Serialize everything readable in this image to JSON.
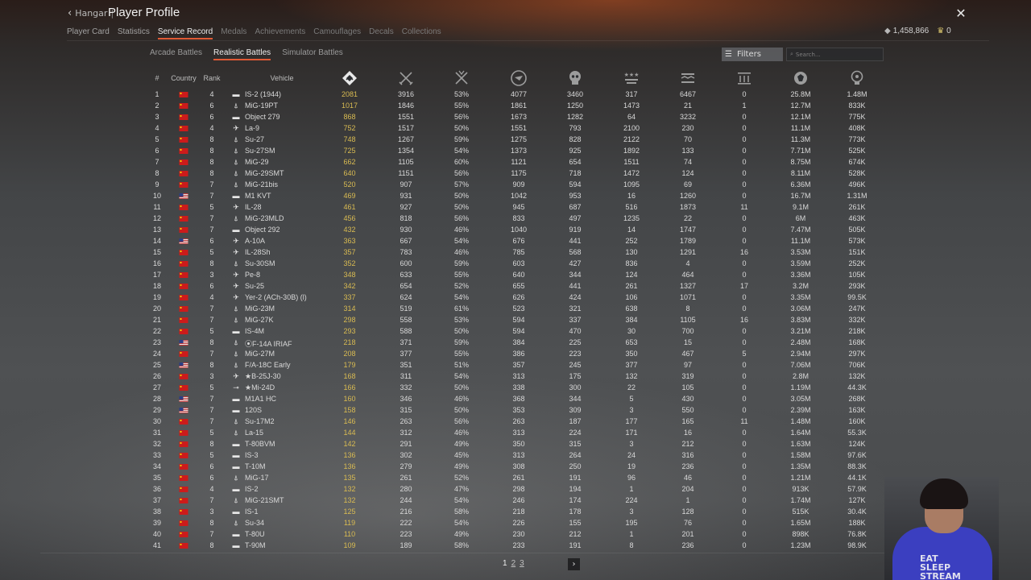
{
  "header": {
    "back_label": "Hangar",
    "title": "Player Profile",
    "tabs": [
      {
        "label": "Player Card",
        "state": "normal"
      },
      {
        "label": "Statistics",
        "state": "normal"
      },
      {
        "label": "Service Record",
        "state": "active"
      },
      {
        "label": "Medals",
        "state": "dim"
      },
      {
        "label": "Achievements",
        "state": "dim"
      },
      {
        "label": "Camouflages",
        "state": "dim"
      },
      {
        "label": "Decals",
        "state": "dim"
      },
      {
        "label": "Collections",
        "state": "dim"
      }
    ],
    "silver_lions": "1,458,866",
    "golden_eagles": "0"
  },
  "mode_tabs": [
    {
      "label": "Arcade Battles",
      "active": false
    },
    {
      "label": "Realistic Battles",
      "active": true
    },
    {
      "label": "Simulator Battles",
      "active": false
    }
  ],
  "filters_label": "Filters",
  "search_placeholder": "Search...",
  "table": {
    "headers": {
      "num": "#",
      "country": "Country",
      "rank": "Rank",
      "vehicle": "Vehicle"
    },
    "stat_icons": [
      "battles-icon",
      "victories-icon",
      "win-rate-icon",
      "respawns-icon",
      "deaths-icon",
      "air-kills-icon",
      "ground-kills-icon",
      "naval-kills-icon",
      "silver-earned-icon",
      "research-points-icon"
    ],
    "rows": [
      {
        "n": "1",
        "c": "cn",
        "r": "4",
        "ic": "tank",
        "v": "IS-2 (1944)",
        "s": [
          "2081",
          "3916",
          "53%",
          "4077",
          "3460",
          "317",
          "6467",
          "0",
          "25.8M",
          "1.48M"
        ]
      },
      {
        "n": "2",
        "c": "cn",
        "r": "6",
        "ic": "jet",
        "v": "MiG-19PT",
        "s": [
          "1017",
          "1846",
          "55%",
          "1861",
          "1250",
          "1473",
          "21",
          "1",
          "12.7M",
          "833K"
        ]
      },
      {
        "n": "3",
        "c": "cn",
        "r": "6",
        "ic": "tank",
        "v": "Object 279",
        "s": [
          "868",
          "1551",
          "56%",
          "1673",
          "1282",
          "64",
          "3232",
          "0",
          "12.1M",
          "775K"
        ]
      },
      {
        "n": "4",
        "c": "cn",
        "r": "4",
        "ic": "prop",
        "v": "La-9",
        "s": [
          "752",
          "1517",
          "50%",
          "1551",
          "793",
          "2100",
          "230",
          "0",
          "11.1M",
          "408K"
        ]
      },
      {
        "n": "5",
        "c": "cn",
        "r": "8",
        "ic": "jet",
        "v": "Su-27",
        "s": [
          "748",
          "1267",
          "59%",
          "1275",
          "828",
          "2122",
          "70",
          "0",
          "11.3M",
          "773K"
        ]
      },
      {
        "n": "6",
        "c": "cn",
        "r": "8",
        "ic": "jet",
        "v": "Su-27SM",
        "s": [
          "725",
          "1354",
          "54%",
          "1373",
          "925",
          "1892",
          "133",
          "0",
          "7.71M",
          "525K"
        ]
      },
      {
        "n": "7",
        "c": "cn",
        "r": "8",
        "ic": "jet",
        "v": "MiG-29",
        "s": [
          "662",
          "1105",
          "60%",
          "1121",
          "654",
          "1511",
          "74",
          "0",
          "8.75M",
          "674K"
        ]
      },
      {
        "n": "8",
        "c": "cn",
        "r": "8",
        "ic": "jet",
        "v": "MiG-29SMT",
        "s": [
          "640",
          "1151",
          "56%",
          "1175",
          "718",
          "1472",
          "124",
          "0",
          "8.11M",
          "528K"
        ]
      },
      {
        "n": "9",
        "c": "cn",
        "r": "7",
        "ic": "jet",
        "v": "MiG-21bis",
        "s": [
          "520",
          "907",
          "57%",
          "909",
          "594",
          "1095",
          "69",
          "0",
          "6.36M",
          "496K"
        ]
      },
      {
        "n": "10",
        "c": "us",
        "r": "7",
        "ic": "tank",
        "v": "M1 KVT",
        "s": [
          "469",
          "931",
          "50%",
          "1042",
          "953",
          "16",
          "1260",
          "0",
          "16.7M",
          "1.31M"
        ]
      },
      {
        "n": "11",
        "c": "cn",
        "r": "5",
        "ic": "prop",
        "v": "IL-28",
        "s": [
          "461",
          "927",
          "50%",
          "945",
          "687",
          "516",
          "1873",
          "11",
          "9.1M",
          "261K"
        ]
      },
      {
        "n": "12",
        "c": "cn",
        "r": "7",
        "ic": "jet",
        "v": "MiG-23MLD",
        "s": [
          "456",
          "818",
          "56%",
          "833",
          "497",
          "1235",
          "22",
          "0",
          "6M",
          "463K"
        ]
      },
      {
        "n": "13",
        "c": "cn",
        "r": "7",
        "ic": "tank",
        "v": "Object 292",
        "s": [
          "432",
          "930",
          "46%",
          "1040",
          "919",
          "14",
          "1747",
          "0",
          "7.47M",
          "505K"
        ]
      },
      {
        "n": "14",
        "c": "us",
        "r": "6",
        "ic": "prop",
        "v": "A-10A",
        "s": [
          "363",
          "667",
          "54%",
          "676",
          "441",
          "252",
          "1789",
          "0",
          "11.1M",
          "573K"
        ]
      },
      {
        "n": "15",
        "c": "cn",
        "r": "5",
        "ic": "prop",
        "v": "IL-28Sh",
        "s": [
          "357",
          "783",
          "46%",
          "785",
          "568",
          "130",
          "1291",
          "16",
          "3.53M",
          "151K"
        ]
      },
      {
        "n": "16",
        "c": "cn",
        "r": "8",
        "ic": "jet",
        "v": "Su-30SM",
        "s": [
          "352",
          "600",
          "59%",
          "603",
          "427",
          "836",
          "4",
          "0",
          "3.59M",
          "252K"
        ]
      },
      {
        "n": "17",
        "c": "cn",
        "r": "3",
        "ic": "prop",
        "v": "Pe-8",
        "s": [
          "348",
          "633",
          "55%",
          "640",
          "344",
          "124",
          "464",
          "0",
          "3.36M",
          "105K"
        ]
      },
      {
        "n": "18",
        "c": "cn",
        "r": "6",
        "ic": "prop",
        "v": "Su-25",
        "s": [
          "342",
          "654",
          "52%",
          "655",
          "441",
          "261",
          "1327",
          "17",
          "3.2M",
          "293K"
        ]
      },
      {
        "n": "19",
        "c": "cn",
        "r": "4",
        "ic": "prop",
        "v": "Yer-2 (ACh-30B) (l)",
        "s": [
          "337",
          "624",
          "54%",
          "626",
          "424",
          "106",
          "1071",
          "0",
          "3.35M",
          "99.5K"
        ]
      },
      {
        "n": "20",
        "c": "cn",
        "r": "7",
        "ic": "jet",
        "v": "MiG-23M",
        "s": [
          "314",
          "519",
          "61%",
          "523",
          "321",
          "638",
          "8",
          "0",
          "3.06M",
          "247K"
        ]
      },
      {
        "n": "21",
        "c": "cn",
        "r": "7",
        "ic": "jet",
        "v": "MiG-27K",
        "s": [
          "298",
          "558",
          "53%",
          "594",
          "337",
          "384",
          "1105",
          "16",
          "3.83M",
          "332K"
        ]
      },
      {
        "n": "22",
        "c": "cn",
        "r": "5",
        "ic": "tank",
        "v": "IS-4M",
        "s": [
          "293",
          "588",
          "50%",
          "594",
          "470",
          "30",
          "700",
          "0",
          "3.21M",
          "218K"
        ]
      },
      {
        "n": "23",
        "c": "us",
        "r": "8",
        "ic": "jet",
        "v": "⦿F-14A IRIAF",
        "s": [
          "218",
          "371",
          "59%",
          "384",
          "225",
          "653",
          "15",
          "0",
          "2.48M",
          "168K"
        ]
      },
      {
        "n": "24",
        "c": "cn",
        "r": "7",
        "ic": "jet",
        "v": "MiG-27M",
        "s": [
          "208",
          "377",
          "55%",
          "386",
          "223",
          "350",
          "467",
          "5",
          "2.94M",
          "297K"
        ]
      },
      {
        "n": "25",
        "c": "us",
        "r": "8",
        "ic": "jet",
        "v": "F/A-18C Early",
        "s": [
          "179",
          "351",
          "51%",
          "357",
          "245",
          "377",
          "97",
          "0",
          "7.06M",
          "706K"
        ]
      },
      {
        "n": "26",
        "c": "cn",
        "r": "3",
        "ic": "prop",
        "v": "★B-25J-30",
        "s": [
          "168",
          "311",
          "54%",
          "313",
          "175",
          "132",
          "319",
          "0",
          "2.8M",
          "132K"
        ]
      },
      {
        "n": "27",
        "c": "cn",
        "r": "5",
        "ic": "heli",
        "v": "★Mi-24D",
        "s": [
          "166",
          "332",
          "50%",
          "338",
          "300",
          "22",
          "105",
          "0",
          "1.19M",
          "44.3K"
        ]
      },
      {
        "n": "28",
        "c": "us",
        "r": "7",
        "ic": "tank",
        "v": "M1A1 HC",
        "s": [
          "160",
          "346",
          "46%",
          "368",
          "344",
          "5",
          "430",
          "0",
          "3.05M",
          "268K"
        ]
      },
      {
        "n": "29",
        "c": "us",
        "r": "7",
        "ic": "tank",
        "v": "120S",
        "s": [
          "158",
          "315",
          "50%",
          "353",
          "309",
          "3",
          "550",
          "0",
          "2.39M",
          "163K"
        ]
      },
      {
        "n": "30",
        "c": "cn",
        "r": "7",
        "ic": "jet",
        "v": "Su-17M2",
        "s": [
          "146",
          "263",
          "56%",
          "263",
          "187",
          "177",
          "165",
          "11",
          "1.48M",
          "160K"
        ]
      },
      {
        "n": "31",
        "c": "cn",
        "r": "5",
        "ic": "jet",
        "v": "La-15",
        "s": [
          "144",
          "312",
          "46%",
          "313",
          "224",
          "171",
          "16",
          "0",
          "1.64M",
          "55.3K"
        ]
      },
      {
        "n": "32",
        "c": "cn",
        "r": "8",
        "ic": "tank",
        "v": "T-80BVM",
        "s": [
          "142",
          "291",
          "49%",
          "350",
          "315",
          "3",
          "212",
          "0",
          "1.63M",
          "124K"
        ]
      },
      {
        "n": "33",
        "c": "cn",
        "r": "5",
        "ic": "tank",
        "v": "IS-3",
        "s": [
          "136",
          "302",
          "45%",
          "313",
          "264",
          "24",
          "316",
          "0",
          "1.58M",
          "97.6K"
        ]
      },
      {
        "n": "34",
        "c": "cn",
        "r": "6",
        "ic": "tank",
        "v": "T-10M",
        "s": [
          "136",
          "279",
          "49%",
          "308",
          "250",
          "19",
          "236",
          "0",
          "1.35M",
          "88.3K"
        ]
      },
      {
        "n": "35",
        "c": "cn",
        "r": "6",
        "ic": "jet",
        "v": "MiG-17",
        "s": [
          "135",
          "261",
          "52%",
          "261",
          "191",
          "96",
          "46",
          "0",
          "1.21M",
          "44.1K"
        ]
      },
      {
        "n": "36",
        "c": "cn",
        "r": "4",
        "ic": "tank",
        "v": "IS-2",
        "s": [
          "132",
          "280",
          "47%",
          "298",
          "194",
          "1",
          "204",
          "0",
          "913K",
          "57.9K"
        ]
      },
      {
        "n": "37",
        "c": "cn",
        "r": "7",
        "ic": "jet",
        "v": "MiG-21SMT",
        "s": [
          "132",
          "244",
          "54%",
          "246",
          "174",
          "224",
          "1",
          "0",
          "1.74M",
          "127K"
        ]
      },
      {
        "n": "38",
        "c": "cn",
        "r": "3",
        "ic": "tank",
        "v": "IS-1",
        "s": [
          "125",
          "216",
          "58%",
          "218",
          "178",
          "3",
          "128",
          "0",
          "515K",
          "30.4K"
        ]
      },
      {
        "n": "39",
        "c": "cn",
        "r": "8",
        "ic": "jet",
        "v": "Su-34",
        "s": [
          "119",
          "222",
          "54%",
          "226",
          "155",
          "195",
          "76",
          "0",
          "1.65M",
          "188K"
        ]
      },
      {
        "n": "40",
        "c": "cn",
        "r": "7",
        "ic": "tank",
        "v": "T-80U",
        "s": [
          "110",
          "223",
          "49%",
          "230",
          "212",
          "1",
          "201",
          "0",
          "898K",
          "76.8K"
        ]
      },
      {
        "n": "41",
        "c": "cn",
        "r": "8",
        "ic": "tank",
        "v": "T-90M",
        "s": [
          "109",
          "189",
          "58%",
          "233",
          "191",
          "8",
          "236",
          "0",
          "1.23M",
          "98.9K"
        ]
      }
    ]
  },
  "pagination": {
    "pages": [
      "1",
      "2",
      "3"
    ],
    "current": "1"
  },
  "webcam": {
    "shirt_text_lines": [
      "EAT",
      "SLEEP",
      "STREAM"
    ]
  }
}
